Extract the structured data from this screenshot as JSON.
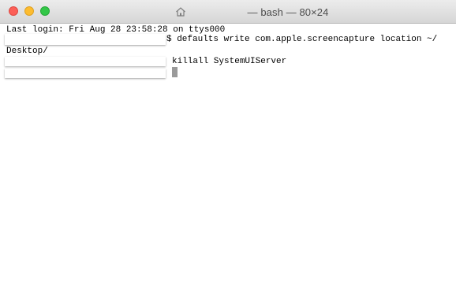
{
  "window": {
    "title": "— bash — 80×24"
  },
  "terminal": {
    "lines": [
      "Last login: Fri Aug 28 23:58:28 on ttys000",
      "$ defaults write com.apple.screencapture location ~/",
      "Desktop/",
      "killall SystemUIServer"
    ]
  },
  "icons": {
    "home": "home-icon"
  },
  "colors": {
    "close": "#fc5f57",
    "minimize": "#fdbc2f",
    "zoom": "#33c748",
    "cursor": "#9a9a9a"
  }
}
